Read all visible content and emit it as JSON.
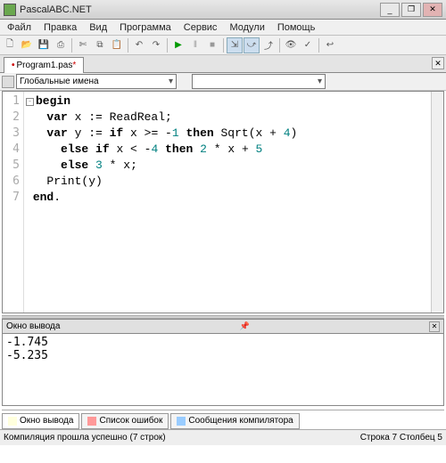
{
  "window": {
    "title": "PascalABC.NET",
    "buttons": {
      "min": "_",
      "max": "❐",
      "close": "✕"
    }
  },
  "menu": {
    "file": "Файл",
    "edit": "Правка",
    "view": "Вид",
    "program": "Программа",
    "service": "Сервис",
    "modules": "Модули",
    "help": "Помощь"
  },
  "toolbar_icons": [
    "new",
    "open",
    "save",
    "saveall",
    "|",
    "cut",
    "copy",
    "paste",
    "|",
    "undo",
    "redo",
    "|",
    "run",
    "pause",
    "stop",
    "|",
    "stepinto",
    "stepover",
    "stepout",
    "|",
    "watch",
    "test",
    "|",
    "wrap"
  ],
  "tab": {
    "name": "Program1.pas",
    "modified": "•"
  },
  "combos": {
    "scope": "Глобальные имена",
    "members": ""
  },
  "code": {
    "lines": [
      "1",
      "2",
      "3",
      "4",
      "5",
      "6",
      "7"
    ]
  },
  "output_panel": {
    "title": "Окно вывода"
  },
  "output_lines": [
    "-1.745",
    "-5.235"
  ],
  "bottom_tabs": {
    "out": "Окно вывода",
    "errors": "Список ошибок",
    "messages": "Сообщения компилятора"
  },
  "status": {
    "left": "Компиляция прошла успешно (7 строк)",
    "right": "Строка  7 Столбец  5"
  }
}
